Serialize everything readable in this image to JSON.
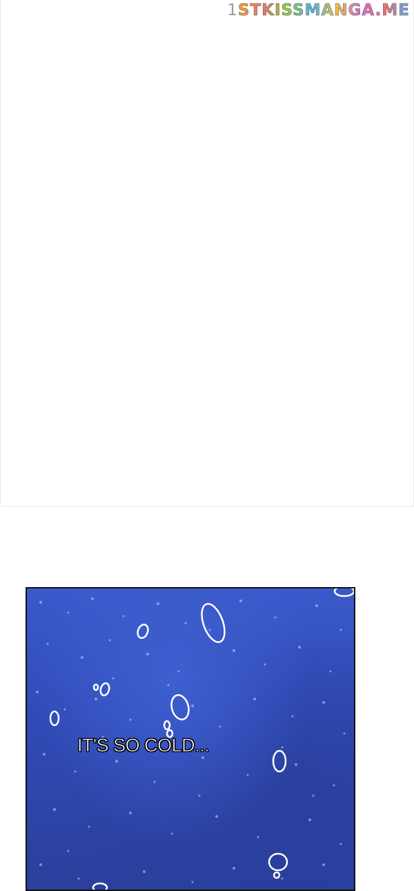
{
  "watermark": {
    "number": "1",
    "text": "STKISSMANGA.ME"
  },
  "panel": {
    "caption": "IT'S SO COLD..."
  },
  "colors": {
    "water_top": "#3b59cb",
    "water_bottom": "#2a3f9b",
    "panel_border": "#111111",
    "divider": "#ececec"
  }
}
